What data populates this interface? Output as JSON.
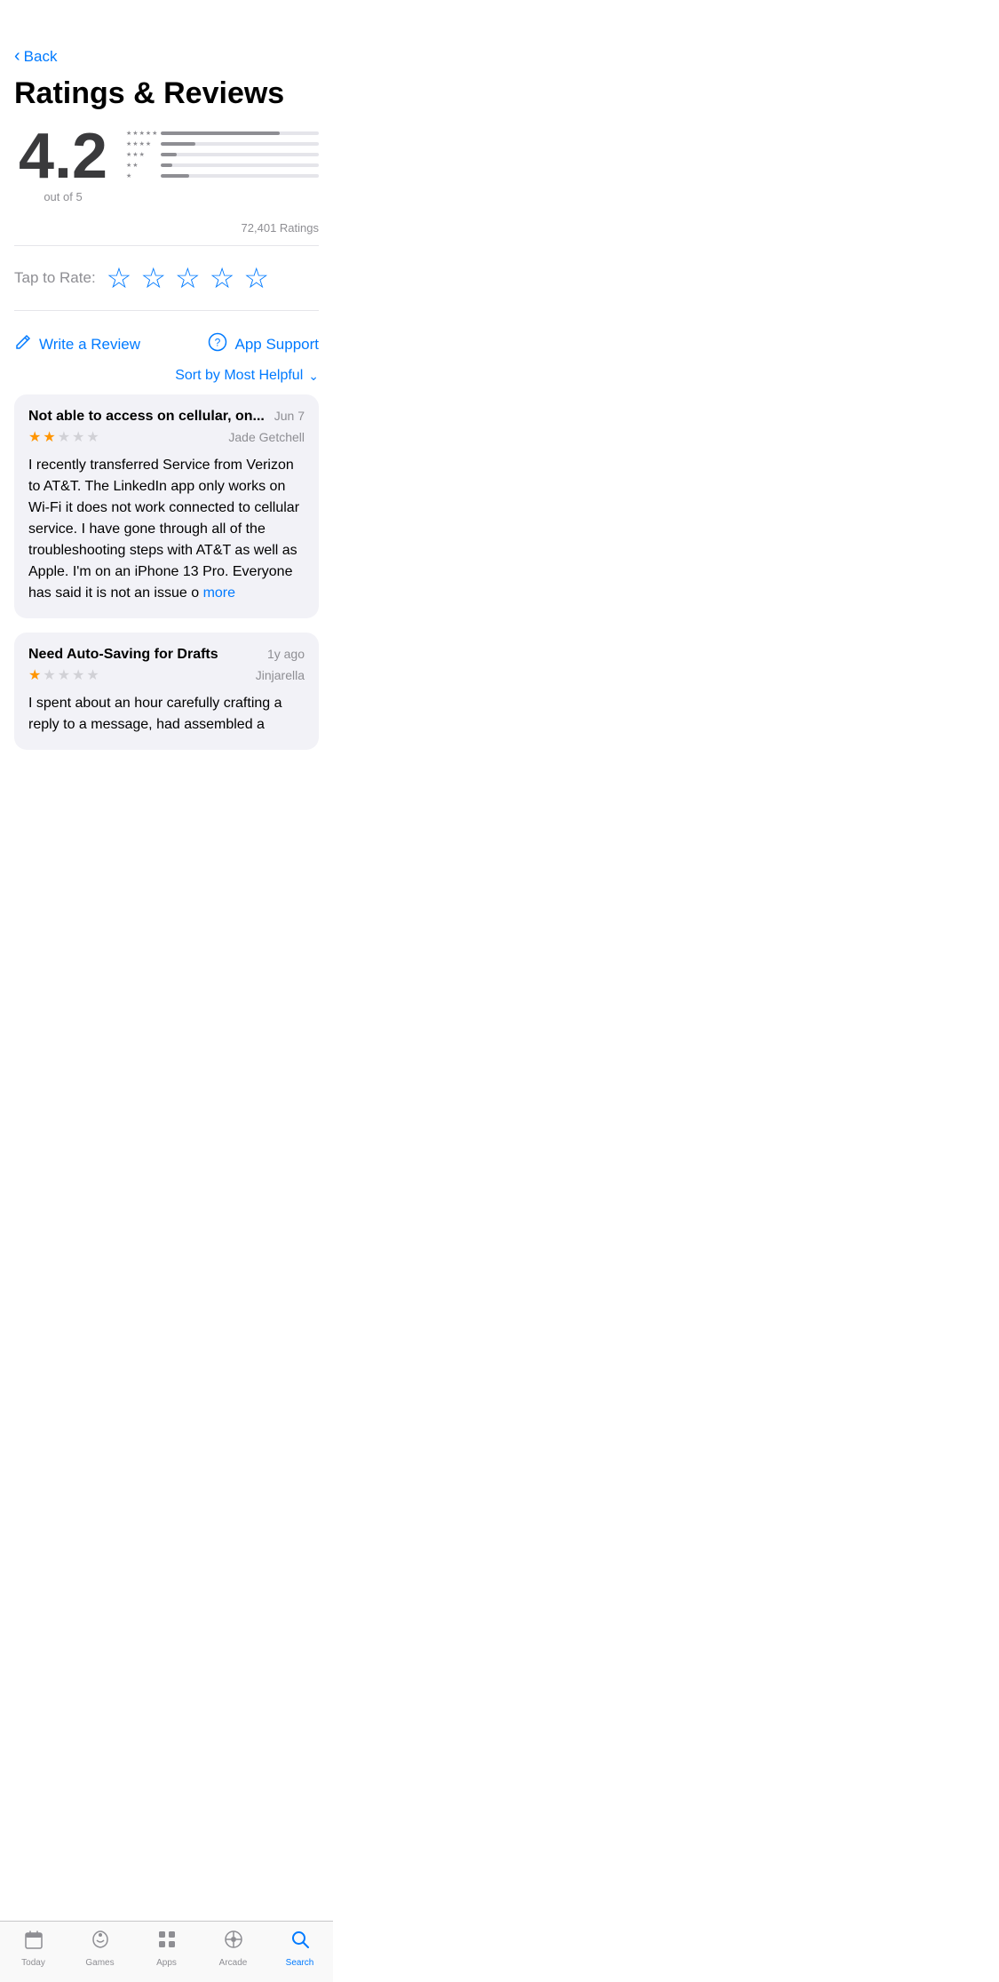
{
  "nav": {
    "back_label": "Back"
  },
  "page": {
    "title": "Ratings & Reviews"
  },
  "rating": {
    "big_number": "4.2",
    "out_of": "out of 5",
    "total_count": "72,401 Ratings",
    "bars": [
      {
        "stars": 5,
        "width_pct": 75
      },
      {
        "stars": 4,
        "width_pct": 22
      },
      {
        "stars": 3,
        "width_pct": 10
      },
      {
        "stars": 2,
        "width_pct": 7
      },
      {
        "stars": 1,
        "width_pct": 18
      }
    ]
  },
  "tap_rate": {
    "label": "Tap to Rate:"
  },
  "actions": {
    "write_review": "Write a Review",
    "app_support": "App Support"
  },
  "sort": {
    "label": "Sort by Most Helpful"
  },
  "reviews": [
    {
      "title": "Not able to access on cellular, on...",
      "date": "Jun 7",
      "stars_filled": 2,
      "stars_empty": 3,
      "author": "Jade Getchell",
      "body": "I recently transferred Service from Verizon to AT&T. The LinkedIn app only works on Wi-Fi it does not work connected to cellular service. I have gone through all of the troubleshooting steps with AT&T as well as Apple. I'm on an iPhone 13 Pro. Everyone has said it is not an issue o",
      "has_more": true
    },
    {
      "title": "Need Auto-Saving for Drafts",
      "date": "1y ago",
      "stars_filled": 1,
      "stars_empty": 4,
      "author": "Jinjarella",
      "body": "I spent about an hour carefully crafting a reply to a message, had assembled a",
      "has_more": false
    }
  ],
  "tabs": [
    {
      "label": "Today",
      "icon": "today",
      "active": false
    },
    {
      "label": "Games",
      "icon": "games",
      "active": false
    },
    {
      "label": "Apps",
      "icon": "apps",
      "active": false
    },
    {
      "label": "Arcade",
      "icon": "arcade",
      "active": false
    },
    {
      "label": "Search",
      "icon": "search",
      "active": true
    }
  ]
}
